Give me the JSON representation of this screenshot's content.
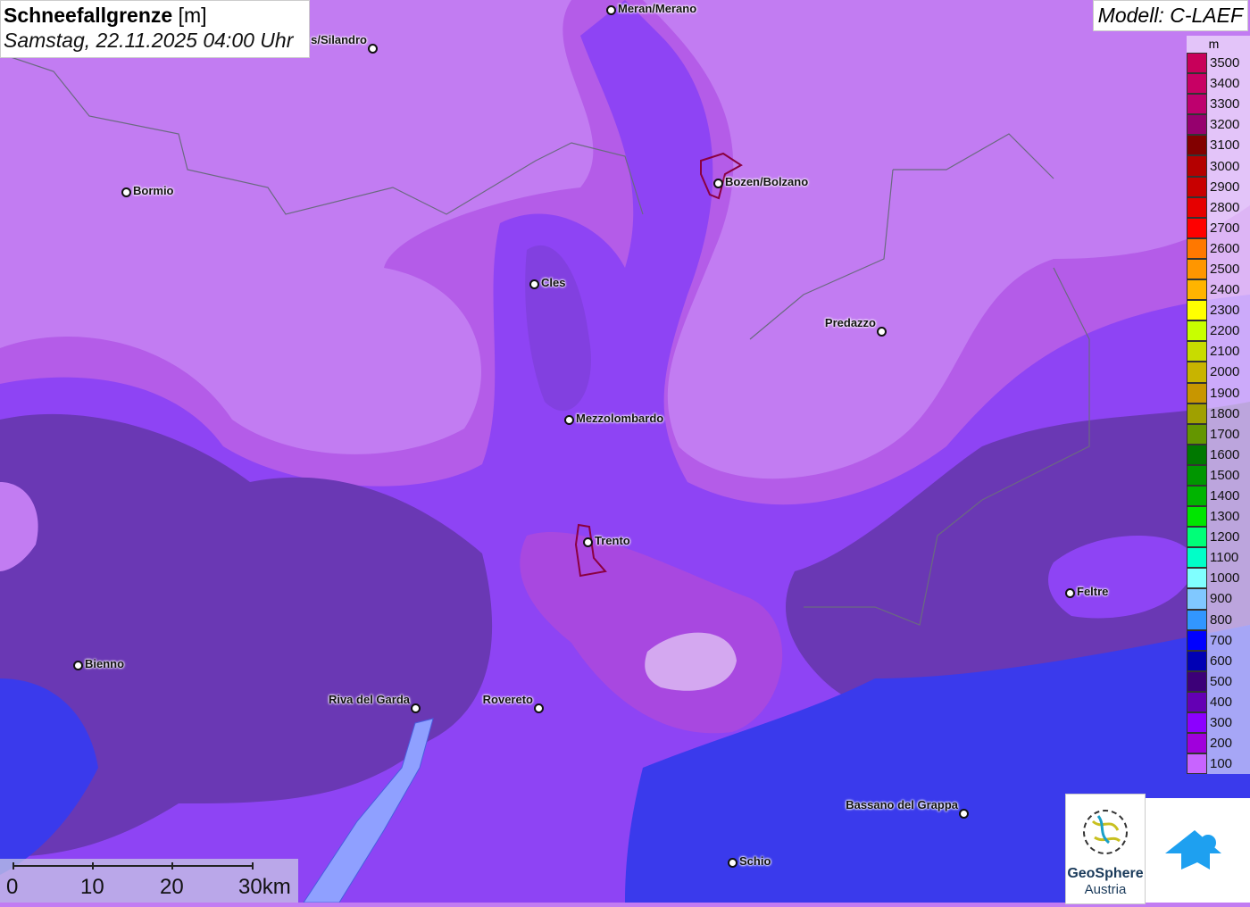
{
  "header": {
    "title": "Schneefallgrenze",
    "unit": "[m]",
    "datetime": "Samstag, 22.11.2025 04:00 Uhr",
    "model": "Modell: C-LAEF"
  },
  "legend": {
    "unit": "m",
    "entries": [
      {
        "value": "3500",
        "color": "#c8005a"
      },
      {
        "value": "3400",
        "color": "#c80064"
      },
      {
        "value": "3300",
        "color": "#be006e"
      },
      {
        "value": "3200",
        "color": "#96006e"
      },
      {
        "value": "3100",
        "color": "#820000"
      },
      {
        "value": "3000",
        "color": "#b40000"
      },
      {
        "value": "2900",
        "color": "#c80000"
      },
      {
        "value": "2800",
        "color": "#e60000"
      },
      {
        "value": "2700",
        "color": "#ff0000"
      },
      {
        "value": "2600",
        "color": "#ff7800"
      },
      {
        "value": "2500",
        "color": "#ff9600"
      },
      {
        "value": "2400",
        "color": "#ffb400"
      },
      {
        "value": "2300",
        "color": "#ffff00"
      },
      {
        "value": "2200",
        "color": "#c8ff00"
      },
      {
        "value": "2100",
        "color": "#c8dc00"
      },
      {
        "value": "2000",
        "color": "#c8b400"
      },
      {
        "value": "1900",
        "color": "#c89600"
      },
      {
        "value": "1800",
        "color": "#a0a000"
      },
      {
        "value": "1700",
        "color": "#649600"
      },
      {
        "value": "1600",
        "color": "#007800"
      },
      {
        "value": "1500",
        "color": "#009600"
      },
      {
        "value": "1400",
        "color": "#00b400"
      },
      {
        "value": "1300",
        "color": "#00e600"
      },
      {
        "value": "1200",
        "color": "#00ff78"
      },
      {
        "value": "1100",
        "color": "#00ffc8"
      },
      {
        "value": "1000",
        "color": "#80ffff"
      },
      {
        "value": "900",
        "color": "#80c8ff"
      },
      {
        "value": "800",
        "color": "#3296ff"
      },
      {
        "value": "700",
        "color": "#0000ff"
      },
      {
        "value": "600",
        "color": "#0000b4"
      },
      {
        "value": "500",
        "color": "#3c0078"
      },
      {
        "value": "400",
        "color": "#6400b4"
      },
      {
        "value": "300",
        "color": "#8c00ff"
      },
      {
        "value": "200",
        "color": "#a000dc"
      },
      {
        "value": "100",
        "color": "#c864ff"
      }
    ]
  },
  "cities": [
    "Meran/Merano",
    "s/Silandro",
    "Bormio",
    "Bozen/Bolzano",
    "Cles",
    "Predazzo",
    "Mezzolombardo",
    "Trento",
    "Feltre",
    "Bienno",
    "Riva del Garda",
    "Rovereto",
    "Bassano del Grappa",
    "Schio"
  ],
  "scale": {
    "labels": [
      "0",
      "10",
      "20",
      "30km"
    ]
  },
  "logos": {
    "geosphere": "GeoSphere",
    "austria": "Austria"
  }
}
